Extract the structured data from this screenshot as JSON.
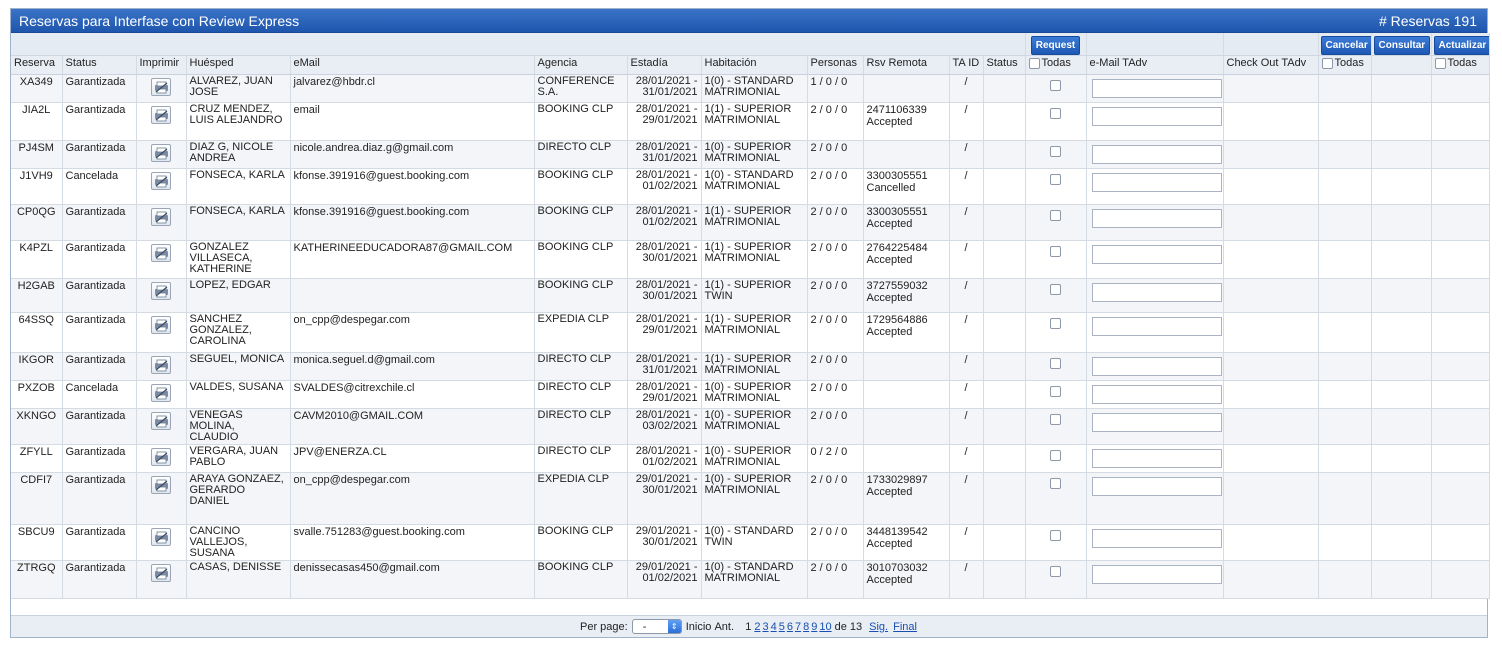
{
  "window": {
    "title": "Reservas para Interfase con Review Express",
    "count_label": "# Reservas 191"
  },
  "buttons": {
    "request": "Request",
    "cancel": "Cancelar",
    "consult": "Consultar",
    "update": "Actualizar"
  },
  "columns": {
    "reserva": "Reserva",
    "status": "Status",
    "imprimir": "Imprimir",
    "huesped": "Huésped",
    "email": "eMail",
    "agencia": "Agencia",
    "estadia": "Estadía",
    "habitacion": "Habitación",
    "personas": "Personas",
    "rsv_remota": "Rsv Remota",
    "ta_id": "TA ID",
    "status2": "Status",
    "todas1": "Todas",
    "email_tadv": "e-Mail TAdv",
    "checkout_tadv": "Check Out TAdv",
    "todas2": "Todas",
    "todas3": "Todas"
  },
  "rows": [
    {
      "id": "XA349",
      "status": "Garantizada",
      "guest": "ALVAREZ, JUAN JOSE",
      "email": "jalvarez@hbdr.cl",
      "agency": "CONFERENCE S.A.",
      "stay_from": "28/01/2021 -",
      "stay_to": "31/01/2021",
      "room": "1(0) - STANDARD MATRIMONIAL",
      "persons": "1 / 0 / 0",
      "remote_id": "",
      "remote_status": "",
      "ta_id": "/"
    },
    {
      "id": "JIA2L",
      "status": "Garantizada",
      "guest": "CRUZ MENDEZ, LUIS ALEJANDRO",
      "email": "email",
      "agency": "BOOKING CLP",
      "stay_from": "28/01/2021 -",
      "stay_to": "29/01/2021",
      "room": "1(1) - SUPERIOR MATRIMONIAL",
      "persons": "2 / 0 / 0",
      "remote_id": "2471106339",
      "remote_status": "Accepted",
      "ta_id": "/"
    },
    {
      "id": "PJ4SM",
      "status": "Garantizada",
      "guest": "DIAZ G, NICOLE ANDREA",
      "email": "nicole.andrea.diaz.g@gmail.com",
      "agency": "DIRECTO CLP",
      "stay_from": "28/01/2021 -",
      "stay_to": "31/01/2021",
      "room": "1(0) - SUPERIOR MATRIMONIAL",
      "persons": "2 / 0 / 0",
      "remote_id": "",
      "remote_status": "",
      "ta_id": "/"
    },
    {
      "id": "J1VH9",
      "status": "Cancelada",
      "guest": "FONSECA, KARLA",
      "email": "kfonse.391916@guest.booking.com",
      "agency": "BOOKING CLP",
      "stay_from": "28/01/2021 -",
      "stay_to": "01/02/2021",
      "room": "1(0) - STANDARD MATRIMONIAL",
      "persons": "2 / 0 / 0",
      "remote_id": "3300305551",
      "remote_status": "Cancelled",
      "ta_id": "/"
    },
    {
      "id": "CP0QG",
      "status": "Garantizada",
      "guest": "FONSECA, KARLA",
      "email": "kfonse.391916@guest.booking.com",
      "agency": "BOOKING CLP",
      "stay_from": "28/01/2021 -",
      "stay_to": "01/02/2021",
      "room": "1(1) - SUPERIOR MATRIMONIAL",
      "persons": "2 / 0 / 0",
      "remote_id": "3300305551",
      "remote_status": "Accepted",
      "ta_id": "/"
    },
    {
      "id": "K4PZL",
      "status": "Garantizada",
      "guest": "GONZALEZ VILLASECA, KATHERINE",
      "email": "KATHERINEEDUCADORA87@GMAIL.COM",
      "agency": "BOOKING CLP",
      "stay_from": "28/01/2021 -",
      "stay_to": "30/01/2021",
      "room": "1(1) - SUPERIOR MATRIMONIAL",
      "persons": "2 / 0 / 0",
      "remote_id": "2764225484",
      "remote_status": "Accepted",
      "ta_id": "/"
    },
    {
      "id": "H2GAB",
      "status": "Garantizada",
      "guest": "LOPEZ, EDGAR",
      "email": "",
      "agency": "BOOKING CLP",
      "stay_from": "28/01/2021 -",
      "stay_to": "30/01/2021",
      "room": "1(1) - SUPERIOR TWIN",
      "persons": "2 / 0 / 0",
      "remote_id": "3727559032",
      "remote_status": "Accepted",
      "ta_id": "/"
    },
    {
      "id": "64SSQ",
      "status": "Garantizada",
      "guest": "SANCHEZ GONZALEZ, CAROLINA",
      "email": "on_cpp@despegar.com",
      "agency": "EXPEDIA CLP",
      "stay_from": "28/01/2021 -",
      "stay_to": "29/01/2021",
      "room": "1(1) - SUPERIOR MATRIMONIAL",
      "persons": "2 / 0 / 0",
      "remote_id": "1729564886",
      "remote_status": "Accepted",
      "ta_id": "/"
    },
    {
      "id": "IKGOR",
      "status": "Garantizada",
      "guest": "SEGUEL, MONICA",
      "email": "monica.seguel.d@gmail.com",
      "agency": "DIRECTO CLP",
      "stay_from": "28/01/2021 -",
      "stay_to": "31/01/2021",
      "room": "1(1) - SUPERIOR MATRIMONIAL",
      "persons": "2 / 0 / 0",
      "remote_id": "",
      "remote_status": "",
      "ta_id": "/"
    },
    {
      "id": "PXZOB",
      "status": "Cancelada",
      "guest": "VALDES, SUSANA",
      "email": "SVALDES@citrexchile.cl",
      "agency": "DIRECTO CLP",
      "stay_from": "28/01/2021 -",
      "stay_to": "29/01/2021",
      "room": "1(0) - SUPERIOR MATRIMONIAL",
      "persons": "2 / 0 / 0",
      "remote_id": "",
      "remote_status": "",
      "ta_id": "/"
    },
    {
      "id": "XKNGO",
      "status": "Garantizada",
      "guest": "VENEGAS MOLINA, CLAUDIO",
      "email": "CAVM2010@GMAIL.COM",
      "agency": "DIRECTO CLP",
      "stay_from": "28/01/2021 -",
      "stay_to": "03/02/2021",
      "room": "1(0) - SUPERIOR MATRIMONIAL",
      "persons": "2 / 0 / 0",
      "remote_id": "",
      "remote_status": "",
      "ta_id": "/"
    },
    {
      "id": "ZFYLL",
      "status": "Garantizada",
      "guest": "VERGARA, JUAN PABLO",
      "email": "JPV@ENERZA.CL",
      "agency": "DIRECTO CLP",
      "stay_from": "28/01/2021 -",
      "stay_to": "01/02/2021",
      "room": "1(0) - SUPERIOR MATRIMONIAL",
      "persons": "0 / 2 / 0",
      "remote_id": "",
      "remote_status": "",
      "ta_id": "/"
    },
    {
      "id": "CDFI7",
      "status": "Garantizada",
      "guest": "ARAYA GONZAEZ, GERARDO DANIEL",
      "email": "on_cpp@despegar.com",
      "agency": "EXPEDIA CLP",
      "stay_from": "29/01/2021 -",
      "stay_to": "30/01/2021",
      "room": "1(0) - SUPERIOR MATRIMONIAL",
      "persons": "2 / 0 / 0",
      "remote_id": "1733029897",
      "remote_status": "Accepted",
      "ta_id": "/"
    },
    {
      "id": "SBCU9",
      "status": "Garantizada",
      "guest": "CANCINO VALLEJOS, SUSANA",
      "email": "svalle.751283@guest.booking.com",
      "agency": "BOOKING CLP",
      "stay_from": "29/01/2021 -",
      "stay_to": "30/01/2021",
      "room": "1(0) - STANDARD TWIN",
      "persons": "2 / 0 / 0",
      "remote_id": "3448139542",
      "remote_status": "Accepted",
      "ta_id": "/"
    },
    {
      "id": "ZTRGQ",
      "status": "Garantizada",
      "guest": "CASAS, DENISSE",
      "email": "denissecasas450@gmail.com",
      "agency": "BOOKING CLP",
      "stay_from": "29/01/2021 -",
      "stay_to": "01/02/2021",
      "room": "1(0) - STANDARD MATRIMONIAL",
      "persons": "2 / 0 / 0",
      "remote_id": "3010703032",
      "remote_status": "Accepted",
      "ta_id": "/"
    }
  ],
  "pagination": {
    "per_page_label": "Per page:",
    "per_page_value": "-",
    "first": "Inicio",
    "prev": "Ant.",
    "current": "1",
    "pages": [
      "2",
      "3",
      "4",
      "5",
      "6",
      "7",
      "8",
      "9",
      "10"
    ],
    "of_label": "de 13",
    "next": "Sig.",
    "last": "Final"
  },
  "icons": {
    "print": "print-icon",
    "select": "chevron-updown-icon"
  }
}
